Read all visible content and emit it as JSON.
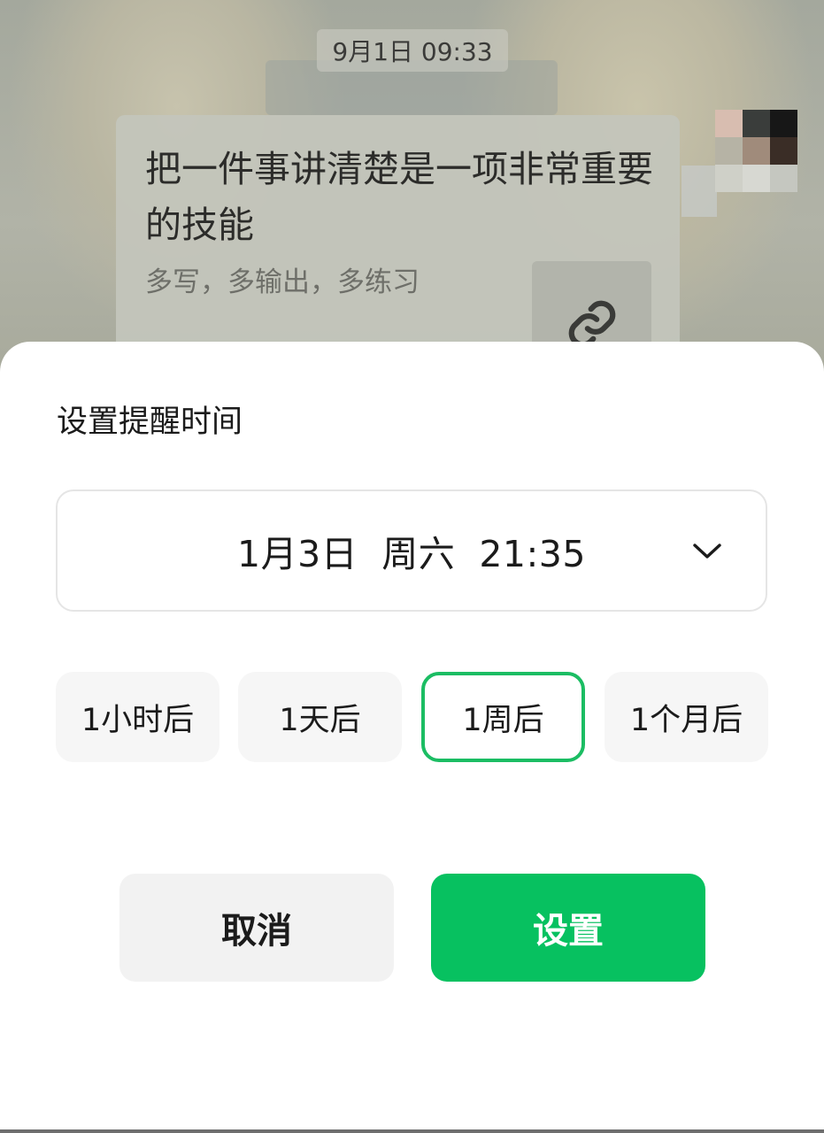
{
  "chat": {
    "timestamp": "9月1日 09:33",
    "message": {
      "title": "把一件事讲清楚是一项非常重要的技能",
      "description": "多写，多输出，多练习",
      "thumb_icon": "link-icon"
    },
    "avatar_icon": "avatar-pixelated"
  },
  "sheet": {
    "title": "设置提醒时间",
    "date_value": "1月3日  周六  21:35",
    "dropdown_icon": "chevron-down-icon",
    "quick_options": [
      {
        "label": "1小时后",
        "selected": false
      },
      {
        "label": "1天后",
        "selected": false
      },
      {
        "label": "1周后",
        "selected": true
      },
      {
        "label": "1个月后",
        "selected": false
      }
    ],
    "cancel_label": "取消",
    "confirm_label": "设置"
  },
  "colors": {
    "accent": "#07c160",
    "selected_border": "#1bbd63",
    "sheet_bg": "#ffffff",
    "button_gray": "#f2f2f2"
  }
}
